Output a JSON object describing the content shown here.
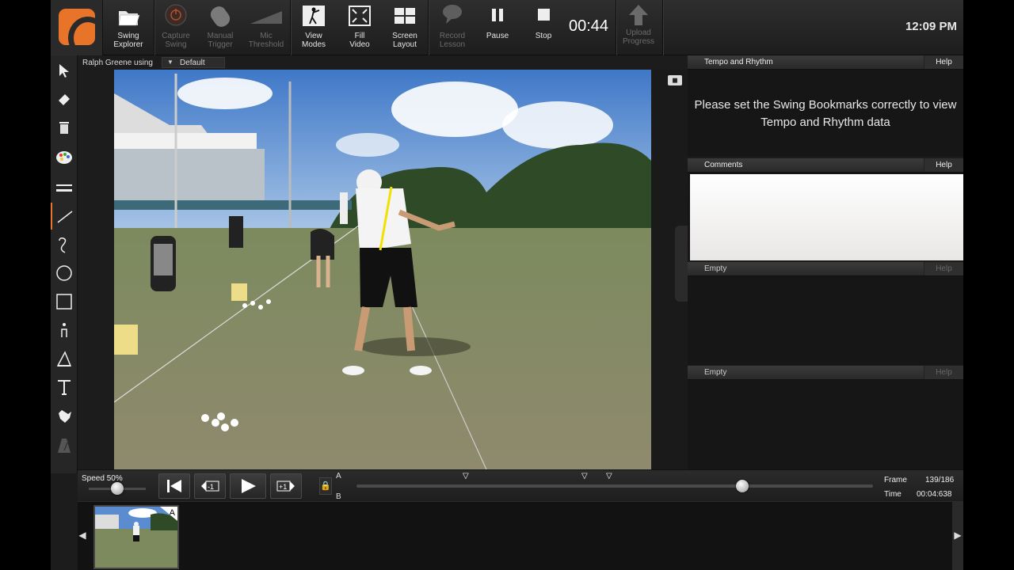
{
  "toolbar": {
    "swing_explorer": "Swing\nExplorer",
    "capture_swing": "Capture\nSwing",
    "manual_trigger": "Manual\nTrigger",
    "mic_threshold": "Mic\nThreshold",
    "view_modes": "View\nModes",
    "fill_video": "Fill\nVideo",
    "screen_layout": "Screen\nLayout",
    "record_lesson": "Record\nLesson",
    "pause": "Pause",
    "stop": "Stop",
    "recording_time": "00:44",
    "upload_progress": "Upload\nProgress",
    "clock": "12:09 PM"
  },
  "userbar": {
    "user": "Ralph Greene using",
    "profile": "Default"
  },
  "panels": {
    "tempo": {
      "title": "Tempo and Rhythm",
      "help": "Help",
      "message": "Please set the Swing Bookmarks correctly to view Tempo and Rhythm data"
    },
    "comments": {
      "title": "Comments",
      "help": "Help"
    },
    "empty1": {
      "title": "Empty",
      "help": "Help"
    },
    "empty2": {
      "title": "Empty",
      "help": "Help"
    }
  },
  "transport": {
    "speed": "Speed 50%",
    "speed_value": 0.5,
    "step_back": "-1",
    "step_fwd": "+1",
    "a_marker": "A",
    "b_marker": "B",
    "frame_label": "Frame",
    "frame_value": "139/186",
    "time_label": "Time",
    "time_value": "00:04:638",
    "position": 0.747
  },
  "filmstrip": {
    "badge": "A"
  },
  "tools": [
    "select-arrow",
    "eraser",
    "trash",
    "palette",
    "lines",
    "line",
    "curve",
    "circle",
    "square",
    "angle-marker",
    "triangle-angle",
    "text",
    "hand",
    "metronome"
  ]
}
